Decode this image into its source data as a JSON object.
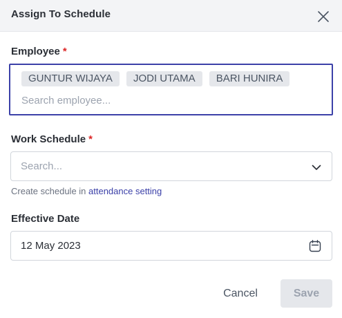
{
  "header": {
    "title": "Assign To Schedule"
  },
  "employee": {
    "label": "Employee",
    "required_mark": "*",
    "selected": [
      "GUNTUR WIJAYA",
      "JODI UTAMA",
      "BARI HUNIRA"
    ],
    "search_placeholder": "Search employee..."
  },
  "work_schedule": {
    "label": "Work Schedule",
    "required_mark": "*",
    "placeholder": "Search...",
    "helper_text": "Create schedule in ",
    "helper_link": "attendance setting"
  },
  "effective_date": {
    "label": "Effective Date",
    "value": "12 May 2023"
  },
  "footer": {
    "cancel_label": "Cancel",
    "save_label": "Save"
  },
  "colors": {
    "accent": "#3b40a8",
    "required": "#dc2626",
    "header_bg": "#f3f4f6",
    "chip_bg": "#e5e7eb",
    "save_disabled_bg": "#e5e7eb"
  },
  "icons": {
    "close": "close-icon",
    "dropdown": "chevron-down-icon",
    "calendar": "calendar-icon"
  }
}
